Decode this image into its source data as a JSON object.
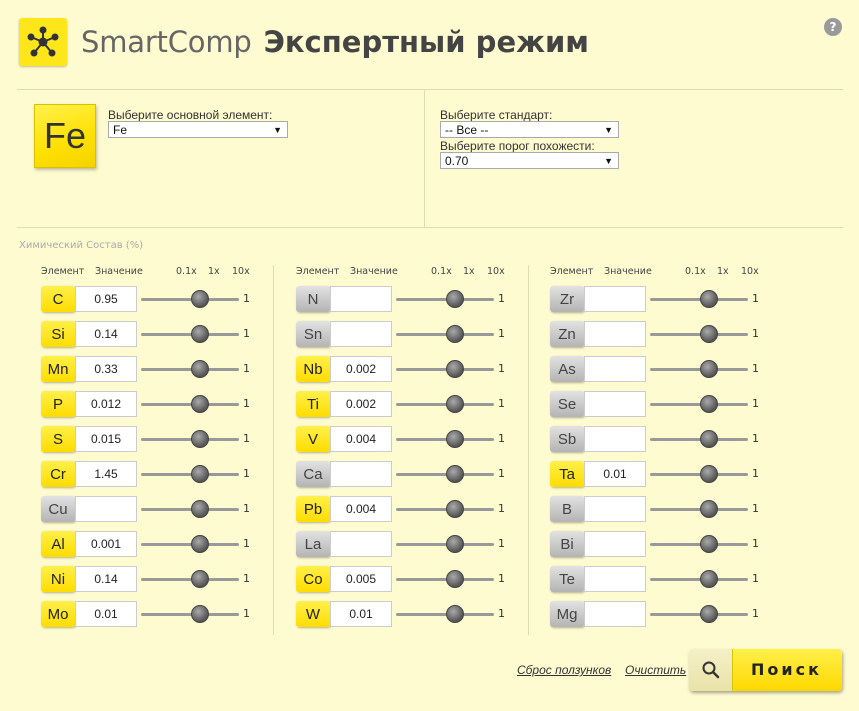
{
  "header": {
    "brand": "SmartComp",
    "mode": "Экспертный режим",
    "help": "?"
  },
  "colors": {
    "accent": "#ffe61a",
    "background": "#fffbd0",
    "inactive": "#c4c4c4"
  },
  "icons": {
    "logo": "network-nodes-icon",
    "help": "question-icon",
    "search": "magnifier-icon"
  },
  "base": {
    "tile": "Fe",
    "label": "Выберите основной элемент:",
    "value": "Fe"
  },
  "standard": {
    "label": "Выберите стандарт:",
    "value": "-- Все --"
  },
  "threshold": {
    "label": "Выберите порог похожести:",
    "value": "0.70"
  },
  "composition": {
    "title": "Химический Состав (%)",
    "headers": {
      "element": "Элемент",
      "value": "Значение",
      "min": "0.1x",
      "mid": "1x",
      "max": "10x"
    },
    "columns": [
      [
        {
          "sym": "C",
          "val": "0.95",
          "active": true,
          "mult": "1"
        },
        {
          "sym": "Si",
          "val": "0.14",
          "active": true,
          "mult": "1"
        },
        {
          "sym": "Mn",
          "val": "0.33",
          "active": true,
          "mult": "1"
        },
        {
          "sym": "P",
          "val": "0.012",
          "active": true,
          "mult": "1"
        },
        {
          "sym": "S",
          "val": "0.015",
          "active": true,
          "mult": "1"
        },
        {
          "sym": "Cr",
          "val": "1.45",
          "active": true,
          "mult": "1"
        },
        {
          "sym": "Cu",
          "val": "",
          "active": false,
          "mult": "1"
        },
        {
          "sym": "Al",
          "val": "0.001",
          "active": true,
          "mult": "1"
        },
        {
          "sym": "Ni",
          "val": "0.14",
          "active": true,
          "mult": "1"
        },
        {
          "sym": "Mo",
          "val": "0.01",
          "active": true,
          "mult": "1"
        }
      ],
      [
        {
          "sym": "N",
          "val": "",
          "active": false,
          "mult": "1"
        },
        {
          "sym": "Sn",
          "val": "",
          "active": false,
          "mult": "1"
        },
        {
          "sym": "Nb",
          "val": "0.002",
          "active": true,
          "mult": "1"
        },
        {
          "sym": "Ti",
          "val": "0.002",
          "active": true,
          "mult": "1"
        },
        {
          "sym": "V",
          "val": "0.004",
          "active": true,
          "mult": "1"
        },
        {
          "sym": "Ca",
          "val": "",
          "active": false,
          "mult": "1"
        },
        {
          "sym": "Pb",
          "val": "0.004",
          "active": true,
          "mult": "1"
        },
        {
          "sym": "La",
          "val": "",
          "active": false,
          "mult": "1"
        },
        {
          "sym": "Co",
          "val": "0.005",
          "active": true,
          "mult": "1"
        },
        {
          "sym": "W",
          "val": "0.01",
          "active": true,
          "mult": "1"
        }
      ],
      [
        {
          "sym": "Zr",
          "val": "",
          "active": false,
          "mult": "1"
        },
        {
          "sym": "Zn",
          "val": "",
          "active": false,
          "mult": "1"
        },
        {
          "sym": "As",
          "val": "",
          "active": false,
          "mult": "1"
        },
        {
          "sym": "Se",
          "val": "",
          "active": false,
          "mult": "1"
        },
        {
          "sym": "Sb",
          "val": "",
          "active": false,
          "mult": "1"
        },
        {
          "sym": "Ta",
          "val": "0.01",
          "active": true,
          "mult": "1"
        },
        {
          "sym": "B",
          "val": "",
          "active": false,
          "mult": "1"
        },
        {
          "sym": "Bi",
          "val": "",
          "active": false,
          "mult": "1"
        },
        {
          "sym": "Te",
          "val": "",
          "active": false,
          "mult": "1"
        },
        {
          "sym": "Mg",
          "val": "",
          "active": false,
          "mult": "1"
        }
      ]
    ]
  },
  "actions": {
    "reset": "Сброс ползунков",
    "clear": "Очистить",
    "search": "Поиск"
  }
}
